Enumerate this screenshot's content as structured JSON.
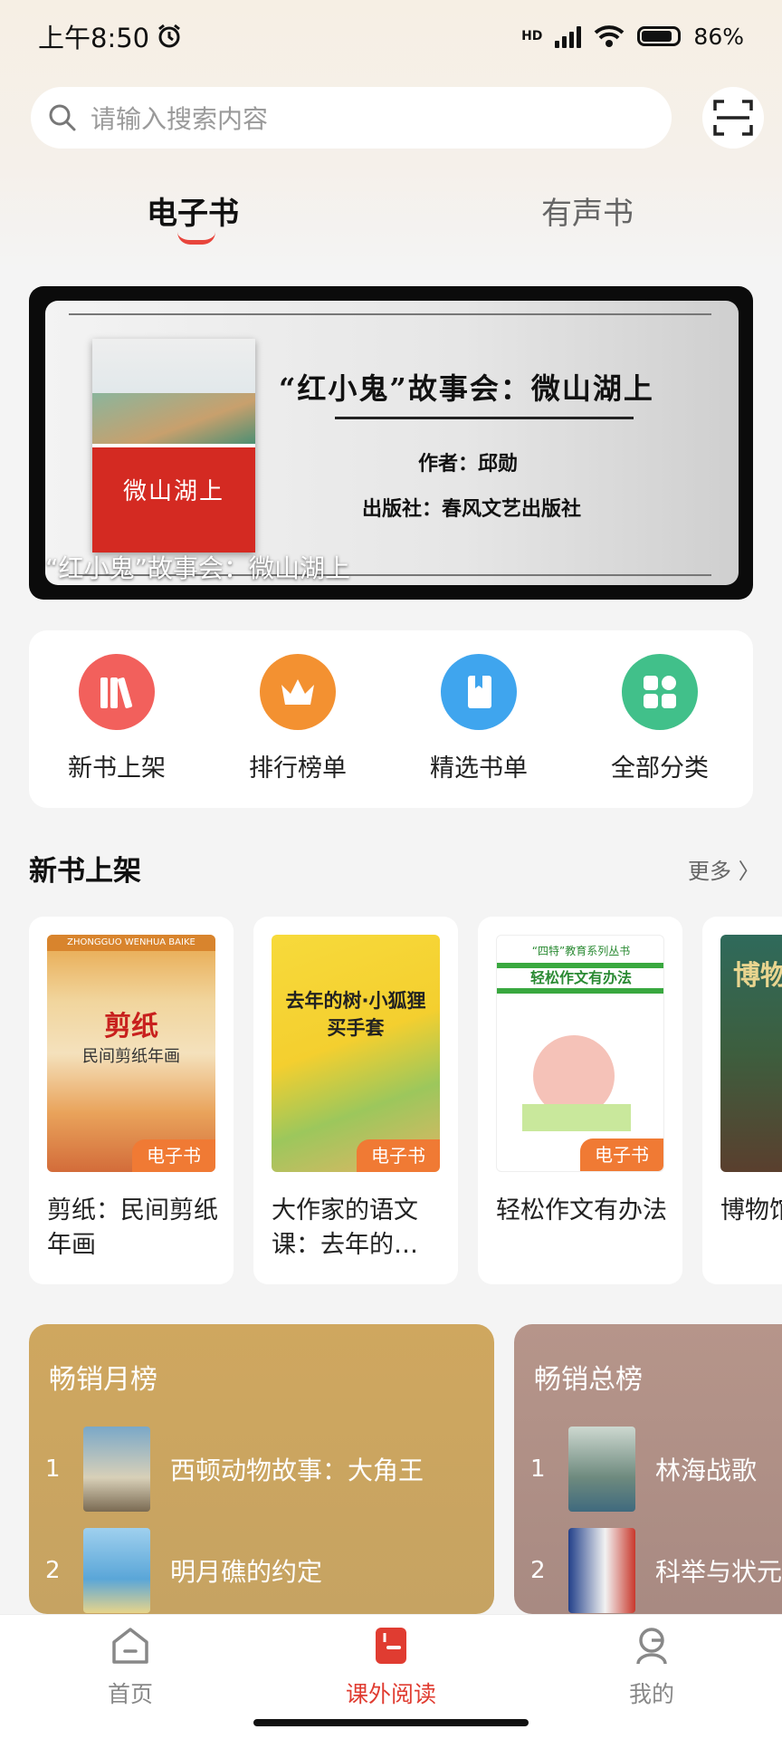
{
  "status_bar": {
    "time": "上午8:50",
    "network": "HD",
    "battery": "86%"
  },
  "search": {
    "placeholder": "请输入搜索内容"
  },
  "tabs": [
    {
      "label": "电子书",
      "active": true
    },
    {
      "label": "有声书",
      "active": false
    }
  ],
  "banner": {
    "book_title": "“红小鬼”故事会：微山湖上",
    "author": "作者：邱勋",
    "publisher": "出版社：春风文艺出版社",
    "cover_title": "微山湖上",
    "caption": "“红小鬼”故事会：微山湖上"
  },
  "menu": [
    {
      "label": "新书上架",
      "icon": "books-icon",
      "color": "#f2605c"
    },
    {
      "label": "排行榜单",
      "icon": "crown-icon",
      "color": "#f39131"
    },
    {
      "label": "精选书单",
      "icon": "bookmark-book-icon",
      "color": "#3fa5ee"
    },
    {
      "label": "全部分类",
      "icon": "grid-icon",
      "color": "#41c08a"
    }
  ],
  "new_books": {
    "title": "新书上架",
    "more": "更多 〉",
    "badge": "电子书",
    "items": [
      {
        "title": "剪纸：民间剪纸年画",
        "cover_text": "剪纸",
        "cover_subtext": "民间剪纸年画",
        "cover_header": "ZHONGGUO WENHUA BAIKE"
      },
      {
        "title": "大作家的语文课：去年的…",
        "cover_text": "去年的树·小狐狸买手套"
      },
      {
        "title": "轻松作文有办法",
        "cover_text": "轻松作文有办法",
        "cover_header": "“四特”教育系列丛书"
      },
      {
        "title": "博物馆·洞中",
        "cover_text": "博物"
      }
    ]
  },
  "rankings": [
    {
      "title": "畅销月榜",
      "items": [
        {
          "rank": "1",
          "name": "西顿动物故事：大角王"
        },
        {
          "rank": "2",
          "name": "明月礁的约定"
        }
      ]
    },
    {
      "title": "畅销总榜",
      "items": [
        {
          "rank": "1",
          "name": "林海战歌"
        },
        {
          "rank": "2",
          "name": "科举与状元"
        }
      ]
    }
  ],
  "bottom_nav": [
    {
      "label": "首页",
      "icon": "home-icon",
      "active": false
    },
    {
      "label": "课外阅读",
      "icon": "reading-icon",
      "active": true
    },
    {
      "label": "我的",
      "icon": "profile-icon",
      "active": false
    }
  ],
  "colors": {
    "accent": "#e03c31",
    "inactive": "#888888"
  }
}
